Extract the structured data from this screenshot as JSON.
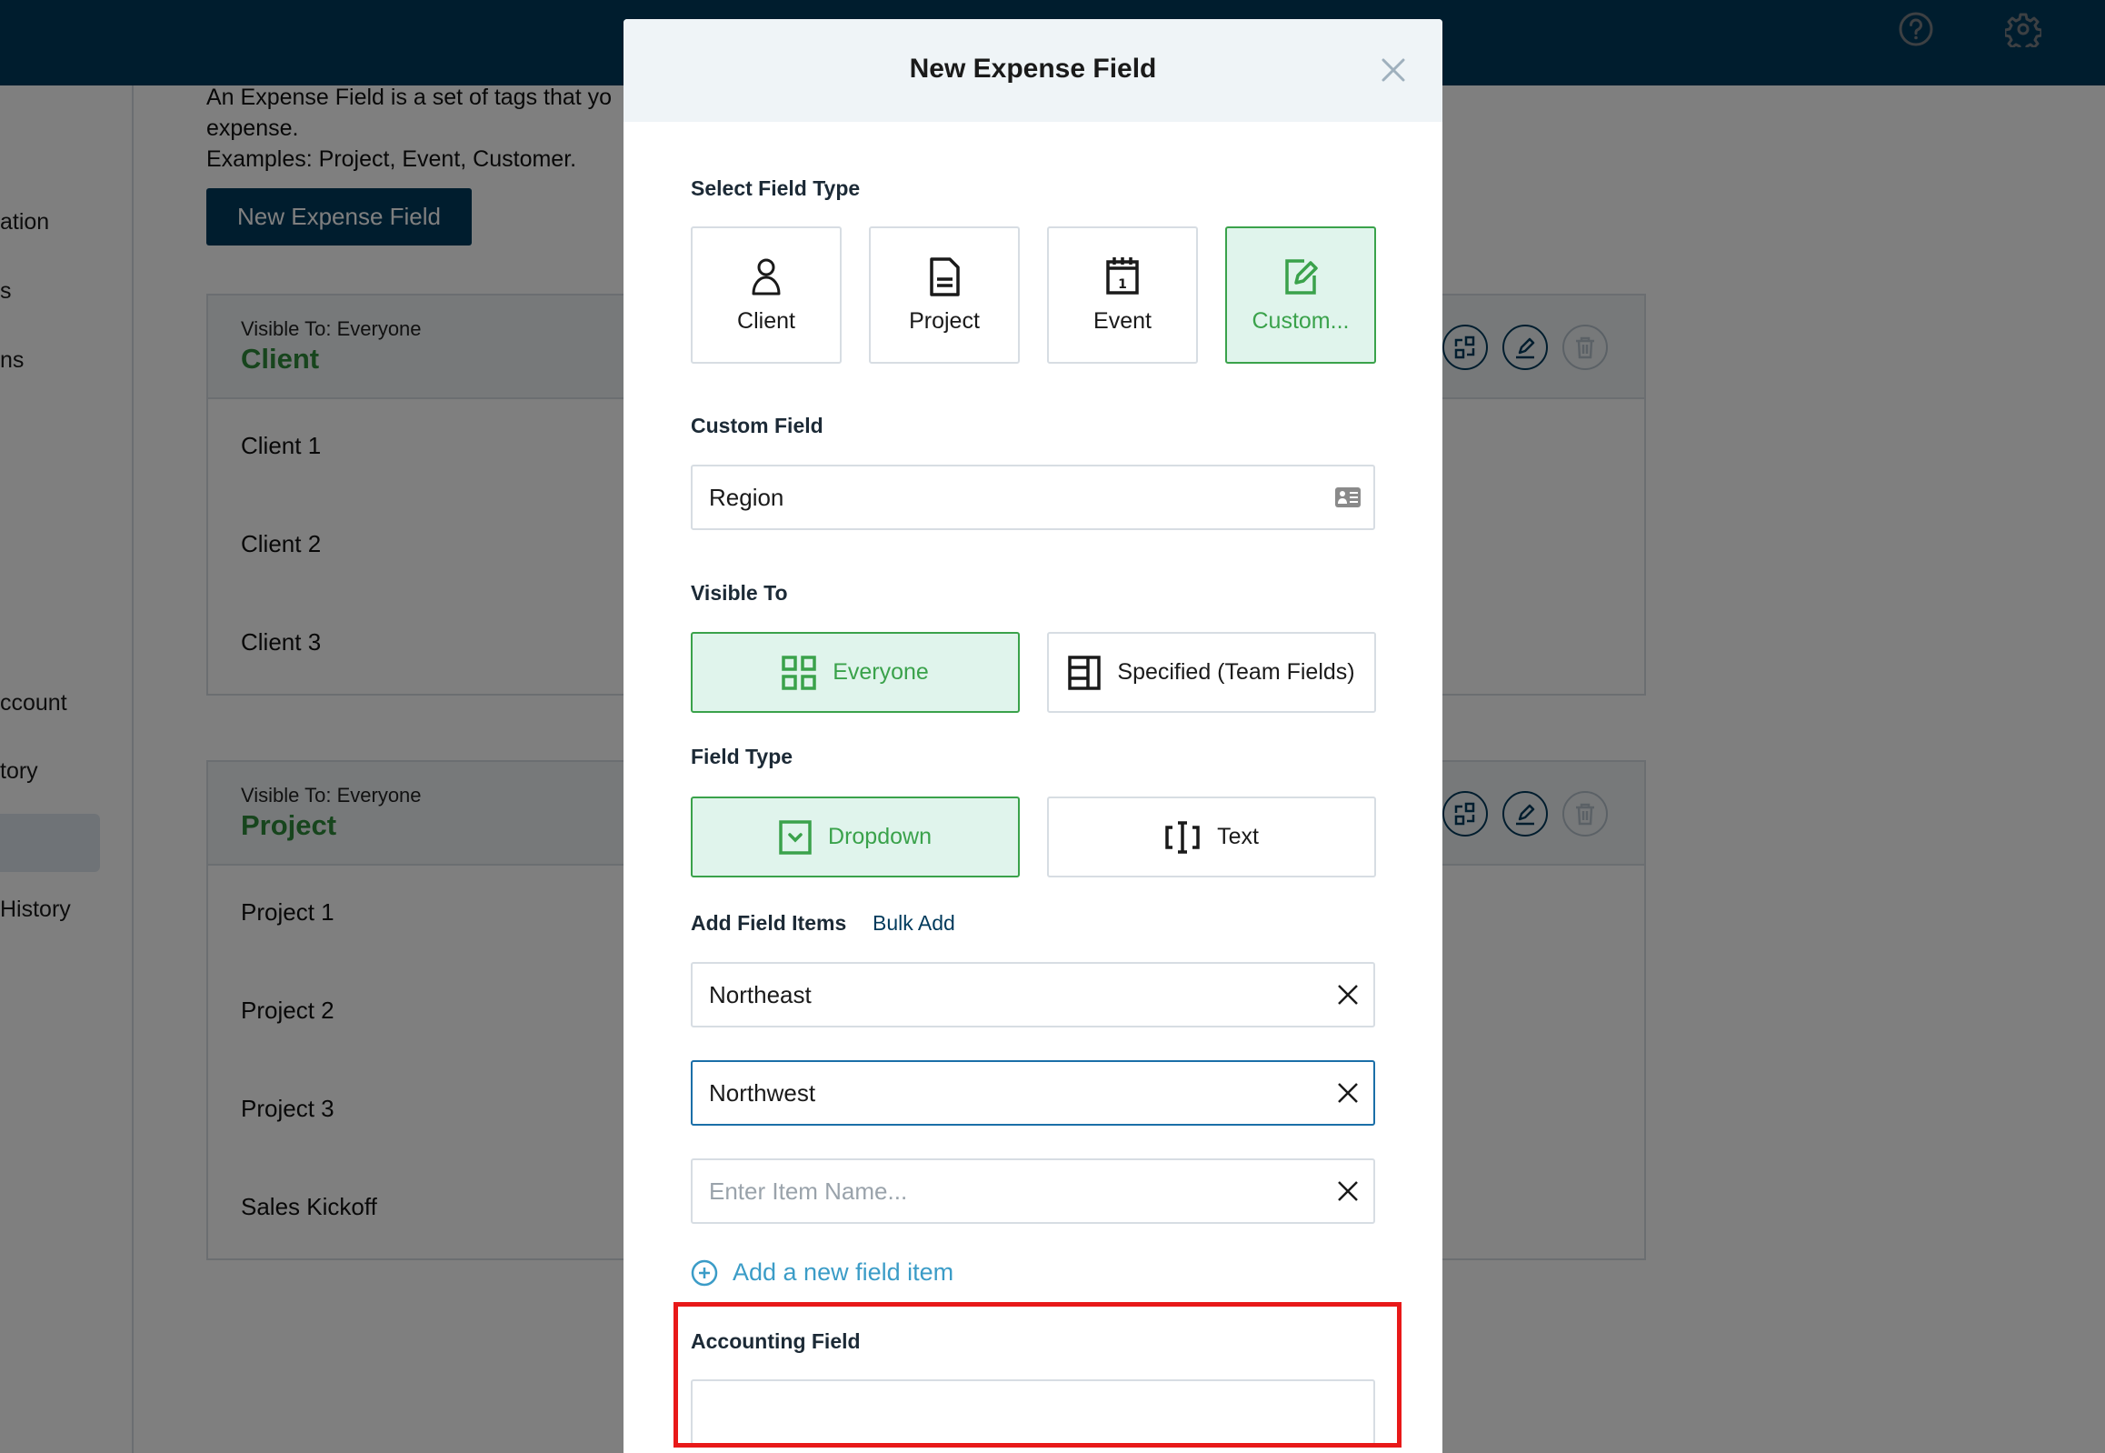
{
  "topbar": {
    "icons": [
      "help-circle-icon",
      "gear-icon"
    ]
  },
  "sidebar": {
    "items": [
      {
        "label": "ation"
      },
      {
        "label": "s"
      },
      {
        "label": "ns"
      },
      {
        "label": "ccount"
      },
      {
        "label": "tory"
      },
      {
        "label": ""
      },
      {
        "label": "History"
      }
    ]
  },
  "main": {
    "intro_line1": "An Expense Field is a set of tags that yo",
    "intro_line2": "expense.",
    "intro_line3": "Examples: Project, Event, Customer.",
    "new_button": "New Expense Field",
    "cards": [
      {
        "visible": "Visible To: Everyone",
        "title": "Client",
        "rows": [
          "Client 1",
          "Client 2",
          "Client 3"
        ]
      },
      {
        "visible": "Visible To: Everyone",
        "title": "Project",
        "rows": [
          "Project 1",
          "Project 2",
          "Project 3",
          "Sales Kickoff"
        ]
      }
    ]
  },
  "modal": {
    "title": "New Expense Field",
    "select_field_type_label": "Select Field Type",
    "field_types": [
      {
        "label": "Client",
        "icon": "person-icon",
        "selected": false
      },
      {
        "label": "Project",
        "icon": "document-icon",
        "selected": false
      },
      {
        "label": "Event",
        "icon": "calendar-icon",
        "selected": false
      },
      {
        "label": "Custom...",
        "icon": "edit-icon",
        "selected": true
      }
    ],
    "custom_field_label": "Custom Field",
    "custom_field_value": "Region",
    "visible_to_label": "Visible To",
    "visible_to_options": [
      {
        "label": "Everyone",
        "selected": true
      },
      {
        "label": "Specified (Team Fields)",
        "selected": false
      }
    ],
    "field_type_label": "Field Type",
    "field_type_options": [
      {
        "label": "Dropdown",
        "selected": true
      },
      {
        "label": "Text",
        "selected": false
      }
    ],
    "add_field_items_label": "Add Field Items",
    "bulk_add_label": "Bulk Add",
    "items": [
      {
        "value": "Northeast",
        "placeholder": ""
      },
      {
        "value": "Northwest",
        "placeholder": ""
      },
      {
        "value": "",
        "placeholder": "Enter Item Name..."
      }
    ],
    "add_new_item_label": "Add a new field item",
    "accounting_field_label": "Accounting Field",
    "accounting_field_value": ""
  },
  "colors": {
    "brand": "#003a5c",
    "accent_green": "#3aa24b",
    "selected_bg": "#e0f4ec",
    "link_blue": "#3b9cc7",
    "highlight_red": "#e81919"
  }
}
